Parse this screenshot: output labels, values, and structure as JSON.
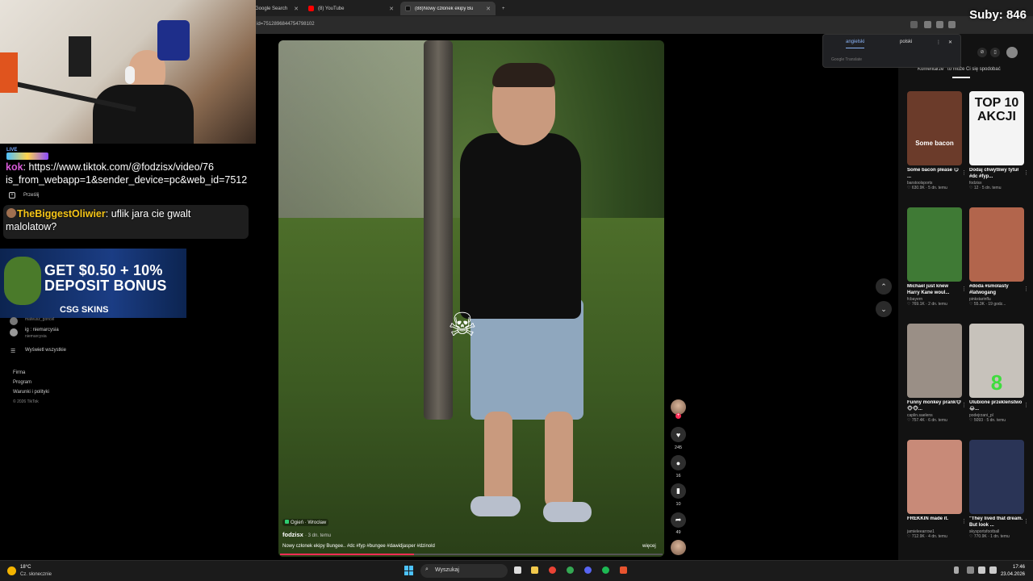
{
  "stream": {
    "subs_label": "Suby: 846"
  },
  "chat": {
    "line1_user": "kok",
    "line1_text": ": https://www.tiktok.com/@fodzisx/video/76",
    "line2_text": "is_from_webapp=1&sender_device=pc&web_id=7512",
    "line3_user": "TheBiggestOliwier",
    "line3_text": ": uflik jara cie gwalt",
    "line4_text": "malolatow?",
    "live_badge": "LIVE"
  },
  "ad": {
    "headline1": "GET $0.50 + 10%",
    "headline2": "DEPOSIT BONUS",
    "brand": "CSG SKINS"
  },
  "browser": {
    "tabs": [
      {
        "label": "Google Search",
        "active": false
      },
      {
        "label": "(8) YouTube",
        "active": false
      },
      {
        "label": "(88)Nowy członek ekipy Bu",
        "active": true
      }
    ],
    "url": "id=7512896844754798102"
  },
  "sidebar": {
    "share": "Prześlij",
    "following": [
      {
        "name": "mateusz_goncel"
      },
      {
        "name": "ig : niemarcysia",
        "handle": "niemarcysia"
      }
    ],
    "show_all": "Wyświetl wszystkie",
    "footer": [
      "Firma",
      "Program",
      "Warunki i polityki"
    ],
    "copyright": "© 2026 TikTok"
  },
  "translate": {
    "tab1": "angielski",
    "tab2": "polski",
    "brand": "Google Translate"
  },
  "video": {
    "location": "Ogień · Wrocław",
    "author": "fodzisx",
    "ago": "· 3 dn. temu",
    "caption": "Nowy członek ekipy Bungee.. #dc #fyp #bungee #dawidjasper  #dzinold",
    "more": "więcej",
    "progress": 0.35,
    "actions": {
      "likes": "245",
      "comments": "16",
      "saves": "10",
      "shares": "49"
    }
  },
  "right_column": {
    "tab_label": "Komentarze",
    "tab_label2": "to może Ci się spodobać",
    "cards": [
      {
        "title": "Some bacon please 😋 ...",
        "author": "barstoolsports",
        "stats": "♡ 630.9K · 5 dn. temu",
        "thumb_text": "Some bacon",
        "bg": "#6b3b2a"
      },
      {
        "title": "Dodaj chwytliwy tytuł #dc #fyp...",
        "author": "fodzisx",
        "stats": "♡ 12 · 5 dn. temu",
        "thumb_text": "TOP 10 AKCJI",
        "bg": "#f4f4f4"
      },
      {
        "title": "Michael just knew Harry Kane woul...",
        "author": "fcbayern",
        "stats": "♡ 769.1K · 2 dn. temu",
        "thumb_text": "",
        "bg": "#3f7a35"
      },
      {
        "title": "#doda #smolasty #latwogang",
        "author": "pinkstarinflu",
        "stats": "♡ 55.3K · 19 godz...",
        "thumb_text": "",
        "bg": "#b2654c"
      },
      {
        "title": "Funny monkey prank🐵🐵🐵...",
        "author": "caplin.saelens",
        "stats": "♡ 757.4K · 6 dn. temu",
        "thumb_text": "",
        "bg": "#9a8f86"
      },
      {
        "title": "Ulubione przekleństwo😂...",
        "author": "podejrzani_pl",
        "stats": "♡ 5093 · 5 dn. temu",
        "thumb_text": "8",
        "bg": "#c7c2bb"
      },
      {
        "title": "FREKKIN made it.",
        "author": "jamieleearrow1",
        "stats": "♡ 712.9K · 4 dn. temu",
        "thumb_text": "",
        "bg": "#c88a78"
      },
      {
        "title": "\"They lived that dream. But look ...",
        "author": "skysportsfootball",
        "stats": "♡ 770.9K · 1 dn. temu",
        "thumb_text": "",
        "bg": "#2a3456"
      }
    ]
  },
  "taskbar": {
    "temp": "18°C",
    "condition": "Cz. słonecznie",
    "search": "Wyszukaj",
    "time": "17:46",
    "date": "23.04.2026"
  }
}
